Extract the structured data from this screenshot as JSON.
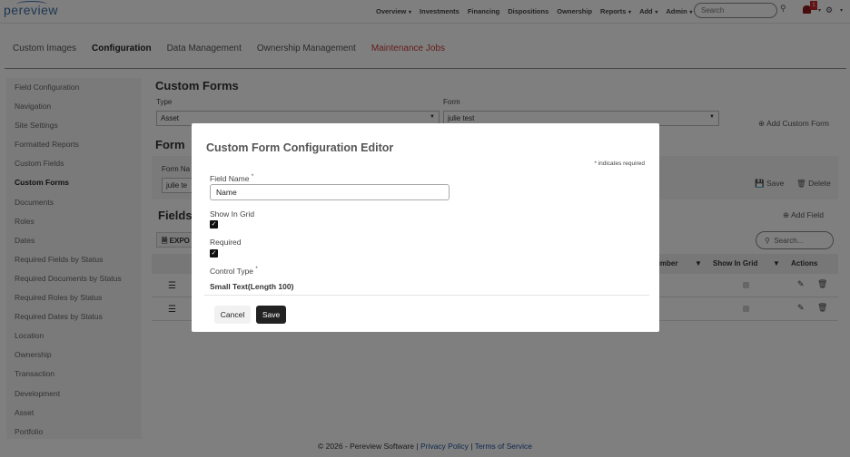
{
  "topbar": {
    "logo": "pereview",
    "nav": [
      {
        "label": "Overview",
        "caret": true
      },
      {
        "label": "Investments",
        "caret": false
      },
      {
        "label": "Financing",
        "caret": false
      },
      {
        "label": "Dispositions",
        "caret": false
      },
      {
        "label": "Ownership",
        "caret": false
      },
      {
        "label": "Reports",
        "caret": true
      },
      {
        "label": "Add",
        "caret": true
      },
      {
        "label": "Admin",
        "caret": true
      }
    ],
    "search_placeholder": "Search",
    "notification_count": "1"
  },
  "tabs": [
    {
      "label": "Custom Images",
      "state": "normal"
    },
    {
      "label": "Configuration",
      "state": "active"
    },
    {
      "label": "Data Management",
      "state": "normal"
    },
    {
      "label": "Ownership Management",
      "state": "normal"
    },
    {
      "label": "Maintenance Jobs",
      "state": "alert"
    }
  ],
  "sidebar": {
    "items": [
      {
        "label": "Field Configuration",
        "active": false
      },
      {
        "label": "Navigation",
        "active": false
      },
      {
        "label": "Site Settings",
        "active": false
      },
      {
        "label": "Formatted Reports",
        "active": false
      },
      {
        "label": "Custom Fields",
        "active": false
      },
      {
        "label": "Custom Forms",
        "active": true
      },
      {
        "label": "Documents",
        "active": false
      },
      {
        "label": "Roles",
        "active": false
      },
      {
        "label": "Dates",
        "active": false
      },
      {
        "label": "Required Fields by Status",
        "active": false
      },
      {
        "label": "Required Documents by Status",
        "active": false
      },
      {
        "label": "Required Roles by Status",
        "active": false
      },
      {
        "label": "Required Dates by Status",
        "active": false
      },
      {
        "label": "Location",
        "active": false
      },
      {
        "label": "Ownership",
        "active": false
      },
      {
        "label": "Transaction",
        "active": false
      },
      {
        "label": "Development",
        "active": false
      },
      {
        "label": "Asset",
        "active": false
      },
      {
        "label": "Portfolio",
        "active": false
      }
    ]
  },
  "main": {
    "title": "Custom Forms",
    "type_label": "Type",
    "type_value": "Asset",
    "form_label": "Form",
    "form_value": "julie test",
    "add_custom_form": "Add Custom Form",
    "form_section_title": "Form",
    "form_name_label": "Form Na",
    "form_name_value": "julie te",
    "save_label": "Save",
    "delete_label": "Delete",
    "fields_title": "Fields",
    "add_field": "Add Field",
    "export_label": "EXPO",
    "grid_search_placeholder": "Search...",
    "grid_headers": {
      "number": "umber",
      "show_in_grid": "Show In Grid",
      "actions": "Actions"
    }
  },
  "modal": {
    "title": "Custom Form Configuration Editor",
    "required_note": "indicates required",
    "field_name_label": "Field Name",
    "field_name_value": "Name",
    "show_in_grid_label": "Show In Grid",
    "show_in_grid_checked": true,
    "required_label": "Required",
    "required_checked": true,
    "control_type_label": "Control Type",
    "control_type_value": "Small Text(Length 100)",
    "cancel_label": "Cancel",
    "save_label": "Save"
  },
  "footer": {
    "copyright": "© 2026 - Pereview Software |",
    "privacy": "Privacy Policy",
    "separator": "|",
    "terms": "Terms of Service"
  }
}
